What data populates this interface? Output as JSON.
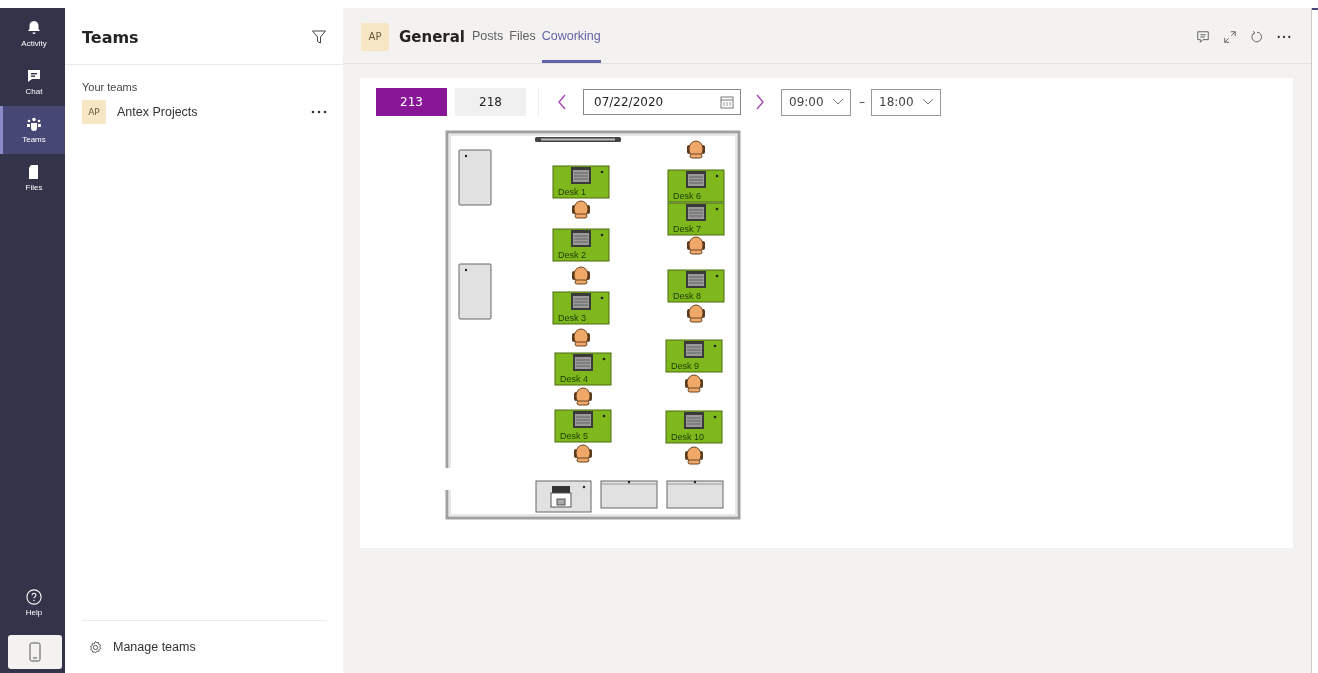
{
  "rail": {
    "items": [
      {
        "kind": "bell",
        "label": "Activity",
        "selected": false
      },
      {
        "kind": "chat",
        "label": "Chat",
        "selected": false
      },
      {
        "kind": "teams",
        "label": "Teams",
        "selected": true
      },
      {
        "kind": "file",
        "label": "Files",
        "selected": false
      }
    ],
    "help": {
      "label": "Help"
    }
  },
  "teams_panel": {
    "title": "Teams",
    "section": "Your teams",
    "teams": [
      {
        "avatar": "AP",
        "name": "Antex Projects"
      }
    ],
    "manage": "Manage teams"
  },
  "channel": {
    "avatar": "AP",
    "name": "General",
    "tabs": [
      {
        "label": "Posts",
        "selected": false
      },
      {
        "label": "Files",
        "selected": false
      },
      {
        "label": "Coworking",
        "selected": true
      }
    ]
  },
  "toolbar": {
    "rooms": [
      {
        "label": "213",
        "selected": true
      },
      {
        "label": "218",
        "selected": false
      }
    ],
    "date": "07/22/2020",
    "start": "09:00",
    "separator": "–",
    "end": "18:00"
  },
  "floor": {
    "desks": [
      {
        "label": "Desk 1"
      },
      {
        "label": "Desk 2"
      },
      {
        "label": "Desk 3"
      },
      {
        "label": "Desk 4"
      },
      {
        "label": "Desk 5"
      },
      {
        "label": "Desk 6"
      },
      {
        "label": "Desk 7"
      },
      {
        "label": "Desk 8"
      },
      {
        "label": "Desk 9"
      },
      {
        "label": "Desk 10"
      }
    ]
  }
}
